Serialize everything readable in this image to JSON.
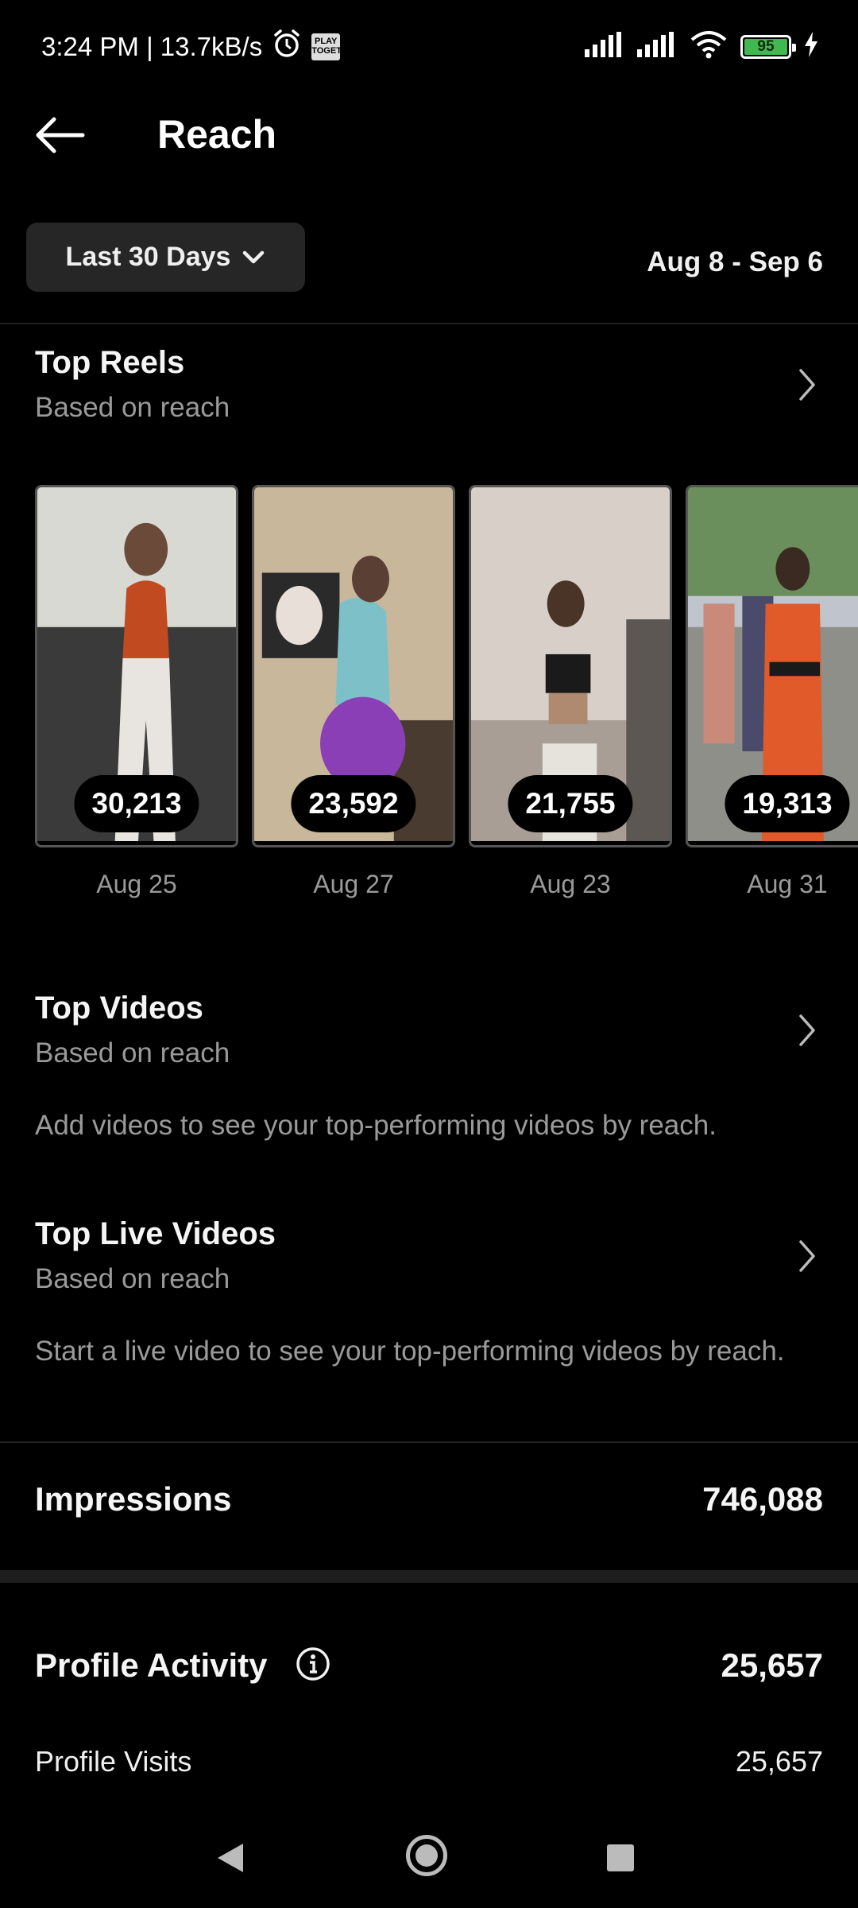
{
  "status_bar": {
    "time_speed": "3:24 PM | 13.7kB/s",
    "play_badge": "PLAY\nTOGETHER",
    "battery_level": "95"
  },
  "header": {
    "title": "Reach"
  },
  "filter": {
    "range_label": "Last 30 Days",
    "date_range": "Aug 8 - Sep 6"
  },
  "top_reels": {
    "title": "Top Reels",
    "subtitle": "Based on reach",
    "items": [
      {
        "count": "30,213",
        "date": "Aug 25",
        "colors": [
          "#d9d9d4",
          "#c14a20",
          "#e8e4e0",
          "#3a3a3a"
        ]
      },
      {
        "count": "23,592",
        "date": "Aug 27",
        "colors": [
          "#c9b79c",
          "#7ec0c8",
          "#8a3fb6",
          "#4a3b30"
        ]
      },
      {
        "count": "21,755",
        "date": "Aug 23",
        "colors": [
          "#d8cfc8",
          "#a89e96",
          "#1a1a1a",
          "#5c5752"
        ]
      },
      {
        "count": "19,313",
        "date": "Aug 31",
        "colors": [
          "#6a8f5c",
          "#c0c4cc",
          "#e05a2a",
          "#8f8f8a"
        ]
      }
    ]
  },
  "top_videos": {
    "title": "Top Videos",
    "subtitle": "Based on reach",
    "empty_message": "Add videos to see your top-performing videos by reach."
  },
  "top_live_videos": {
    "title": "Top Live Videos",
    "subtitle": "Based on reach",
    "empty_message": "Start a live video to see your top-performing videos by reach."
  },
  "impressions": {
    "label": "Impressions",
    "value": "746,088"
  },
  "profile_activity": {
    "label": "Profile Activity",
    "value": "25,657",
    "rows": [
      {
        "label": "Profile Visits",
        "value": "25,657"
      }
    ]
  },
  "colors": {
    "background": "#000000",
    "button_bg": "#262626",
    "secondary_text": "#9a9a9a",
    "battery": "#3fb950"
  }
}
